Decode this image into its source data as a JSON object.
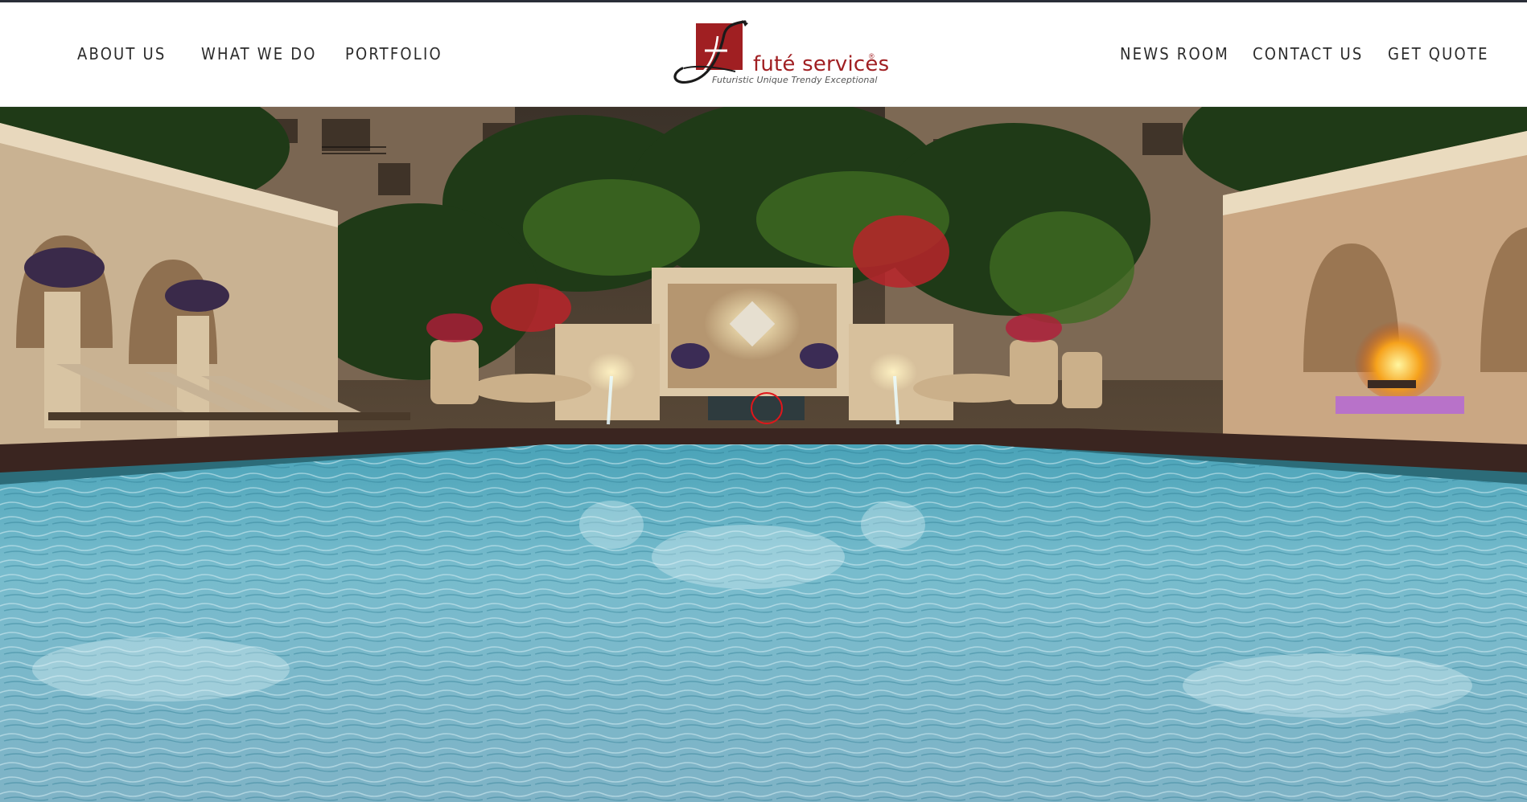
{
  "nav": {
    "left": [
      "ABOUT US",
      "WHAT WE DO",
      "PORTFOLIO"
    ],
    "right": [
      "NEWS ROOM",
      "CONTACT US",
      "GET QUOTE"
    ]
  },
  "logo": {
    "name": "futé services",
    "registered": "®",
    "tagline": "Futuristic Unique Trendy Exceptional"
  },
  "hero": {
    "image": "pool-courtyard-night-render"
  },
  "colors": {
    "brand_red": "#a01f22",
    "nav_text": "#2b2b2b",
    "top_strip": "#2a2e38",
    "pool": "#6fb8cc"
  },
  "icons": [
    "logo-monogram-icon",
    "cursor-ring-icon"
  ]
}
